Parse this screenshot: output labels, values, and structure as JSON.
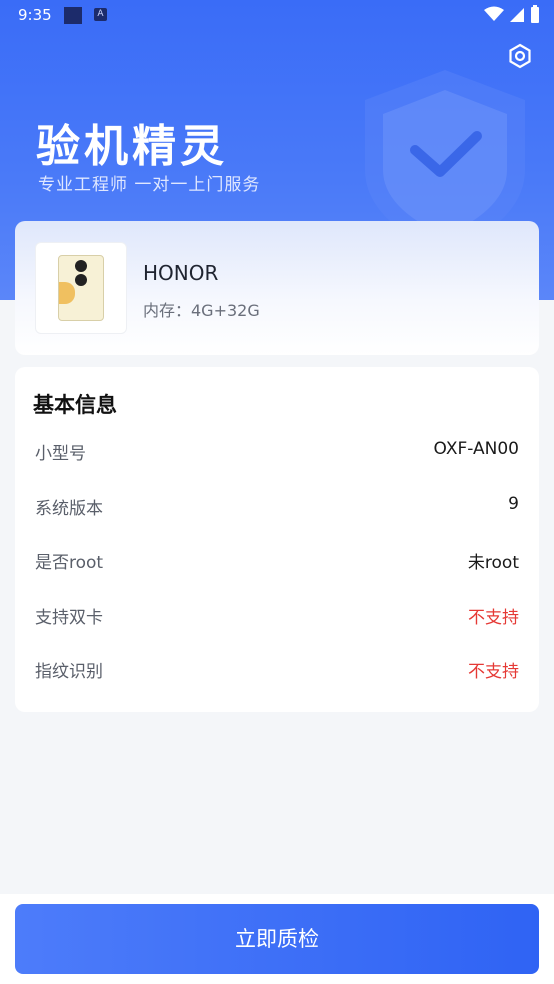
{
  "status_bar": {
    "time": "9:35",
    "notification_icon_letter": "A"
  },
  "header": {
    "title": "验机精灵",
    "subtitle": "专业工程师 一对一上门服务",
    "settings_icon": "gear-icon",
    "decoration_icon": "shield-check-icon"
  },
  "device": {
    "brand": "HONOR",
    "memory": "内存：4G+32G"
  },
  "basic_info": {
    "title": "基本信息",
    "rows": [
      {
        "label": "小型号",
        "value": "OXF-AN00",
        "status": "normal"
      },
      {
        "label": "系统版本",
        "value": "9",
        "status": "normal"
      },
      {
        "label": "是否root",
        "value": "未root",
        "status": "normal"
      },
      {
        "label": "支持双卡",
        "value": "不支持",
        "status": "negative"
      },
      {
        "label": "指纹识别",
        "value": "不支持",
        "status": "negative"
      }
    ]
  },
  "action": {
    "label": "立即质检"
  },
  "colors": {
    "primary": "#3a6cf7",
    "negative": "#e53935",
    "background": "#f4f6f9"
  }
}
